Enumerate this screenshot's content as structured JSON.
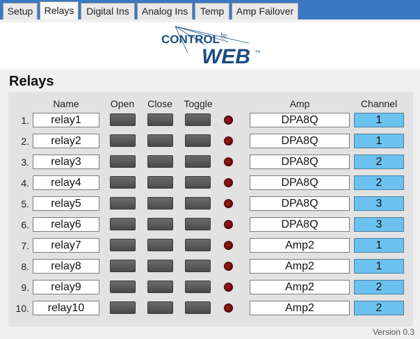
{
  "tabs": [
    {
      "label": "Setup",
      "active": false
    },
    {
      "label": "Relays",
      "active": true
    },
    {
      "label": "Digital Ins",
      "active": false
    },
    {
      "label": "Analog Ins",
      "active": false
    },
    {
      "label": "Temp",
      "active": false
    },
    {
      "label": "Amp Failover",
      "active": false
    }
  ],
  "logo": {
    "line1": "CONTROL",
    "by": "by",
    "line2": "WEB",
    "tm": "TM"
  },
  "page_title": "Relays",
  "columns": {
    "name": "Name",
    "open": "Open",
    "close": "Close",
    "toggle": "Toggle",
    "amp": "Amp",
    "channel": "Channel"
  },
  "relays": [
    {
      "num": "1.",
      "name": "relay1",
      "amp": "DPA8Q",
      "channel": "1"
    },
    {
      "num": "2.",
      "name": "relay2",
      "amp": "DPA8Q",
      "channel": "1"
    },
    {
      "num": "3.",
      "name": "relay3",
      "amp": "DPA8Q",
      "channel": "2"
    },
    {
      "num": "4.",
      "name": "relay4",
      "amp": "DPA8Q",
      "channel": "2"
    },
    {
      "num": "5.",
      "name": "relay5",
      "amp": "DPA8Q",
      "channel": "3"
    },
    {
      "num": "6.",
      "name": "relay6",
      "amp": "DPA8Q",
      "channel": "3"
    },
    {
      "num": "7.",
      "name": "relay7",
      "amp": "Amp2",
      "channel": "1"
    },
    {
      "num": "8.",
      "name": "relay8",
      "amp": "Amp2",
      "channel": "1"
    },
    {
      "num": "9.",
      "name": "relay9",
      "amp": "Amp2",
      "channel": "2"
    },
    {
      "num": "10.",
      "name": "relay10",
      "amp": "Amp2",
      "channel": "2"
    }
  ],
  "version": "Version 0.3",
  "colors": {
    "tabbar": "#3a78c3",
    "channel_bg": "#6cc2ef",
    "led_off": "#7a0a0a",
    "logo_blue": "#1a4d80"
  }
}
